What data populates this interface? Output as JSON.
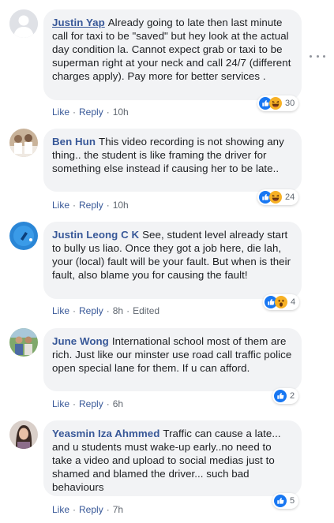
{
  "comments": [
    {
      "author": "Justin Yap",
      "text": "Already going to late then last minute call for taxi to be \"saved\" but hey look at the actual day condition la. Cannot expect grab or taxi to be superman right at your neck and call 24/7 (different charges apply). Pay more for better services .",
      "like": "Like",
      "reply": "Reply",
      "time": "10h",
      "reaction_count": "30",
      "reactions": [
        "like-icon",
        "haha-icon"
      ]
    },
    {
      "author": "Ben Hun",
      "text": "This video recording is not showing any thing.. the student is like framing the driver for something else instead if causing her to be late..",
      "like": "Like",
      "reply": "Reply",
      "time": "10h",
      "reaction_count": "24",
      "reactions": [
        "like-icon",
        "haha-icon"
      ]
    },
    {
      "author": "Justin Leong C K",
      "text": "See, student level already start to bully us liao. Once they got a job here, die lah, your (local) fault will be your fault. But when is their fault, also blame you for causing the fault!",
      "like": "Like",
      "reply": "Reply",
      "time": "8h",
      "edited": "Edited",
      "reaction_count": "4",
      "reactions": [
        "like-icon",
        "wow-icon"
      ]
    },
    {
      "author": "June Wong",
      "text": "International school most of them are rich. Just like our minster use road call traffic police open special lane for them. If u can afford.",
      "like": "Like",
      "reply": "Reply",
      "time": "6h",
      "reaction_count": "2",
      "reactions": [
        "like-icon"
      ]
    },
    {
      "author": "Yeasmin Iza Ahmmed",
      "text": "Traffic can cause a late... and u students must wake-up early..no need to take a video and upload to social medias just to shamed and blamed the driver... such bad behaviours",
      "like": "Like",
      "reply": "Reply",
      "time": "7h",
      "reaction_count": "5",
      "reactions": [
        "like-icon"
      ]
    }
  ],
  "colors": {
    "link": "#385898",
    "bubble": "#f2f3f5",
    "meta": "#606770",
    "like_blue": "#1877f2",
    "emoji_yellow": "#f7b125"
  }
}
